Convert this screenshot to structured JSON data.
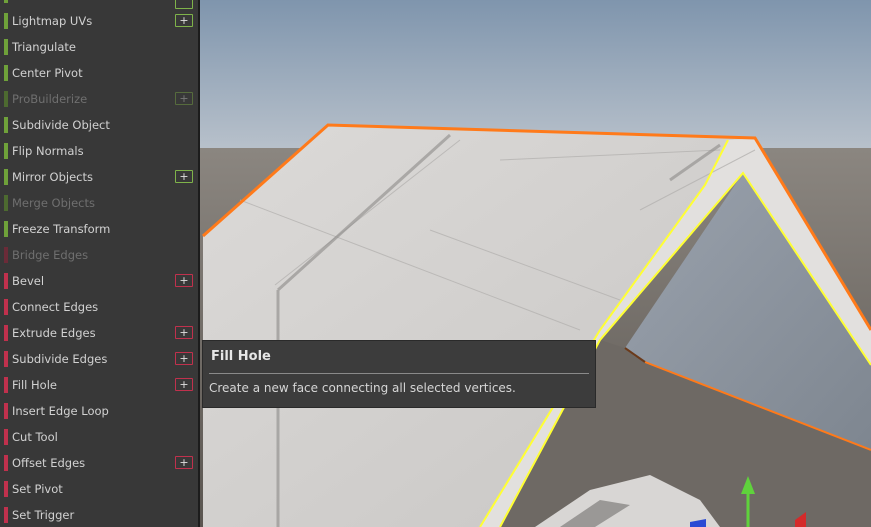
{
  "tool_panel": {
    "items": [
      {
        "label": "Lightmap UVs",
        "color": "green",
        "has_plus": true,
        "enabled": true
      },
      {
        "label": "Triangulate",
        "color": "green",
        "has_plus": false,
        "enabled": true
      },
      {
        "label": "Center Pivot",
        "color": "green",
        "has_plus": false,
        "enabled": true
      },
      {
        "label": "ProBuilderize",
        "color": "green",
        "has_plus": true,
        "enabled": false
      },
      {
        "label": "Subdivide Object",
        "color": "green",
        "has_plus": false,
        "enabled": true
      },
      {
        "label": "Flip Normals",
        "color": "green",
        "has_plus": false,
        "enabled": true
      },
      {
        "label": "Mirror Objects",
        "color": "green",
        "has_plus": true,
        "enabled": true
      },
      {
        "label": "Merge Objects",
        "color": "green",
        "has_plus": false,
        "enabled": false
      },
      {
        "label": "Freeze Transform",
        "color": "green",
        "has_plus": false,
        "enabled": true
      },
      {
        "label": "Bridge Edges",
        "color": "red",
        "has_plus": false,
        "enabled": false
      },
      {
        "label": "Bevel",
        "color": "red",
        "has_plus": true,
        "enabled": true
      },
      {
        "label": "Connect Edges",
        "color": "red",
        "has_plus": false,
        "enabled": true
      },
      {
        "label": "Extrude Edges",
        "color": "red",
        "has_plus": true,
        "enabled": true
      },
      {
        "label": "Subdivide Edges",
        "color": "red",
        "has_plus": true,
        "enabled": true
      },
      {
        "label": "Fill Hole",
        "color": "red",
        "has_plus": true,
        "enabled": true
      },
      {
        "label": "Insert Edge Loop",
        "color": "red",
        "has_plus": false,
        "enabled": true
      },
      {
        "label": "Cut Tool",
        "color": "red",
        "has_plus": false,
        "enabled": true
      },
      {
        "label": "Offset Edges",
        "color": "red",
        "has_plus": true,
        "enabled": true
      },
      {
        "label": "Set Pivot",
        "color": "red",
        "has_plus": false,
        "enabled": true
      },
      {
        "label": "Set Trigger",
        "color": "red",
        "has_plus": false,
        "enabled": true
      }
    ],
    "plus_glyph": "+"
  },
  "tooltip": {
    "title": "Fill Hole",
    "description": "Create a new face connecting all selected vertices."
  },
  "colors": {
    "panel_bg": "#383838",
    "green_category": "#6fa13a",
    "red_category": "#c0314d",
    "selection_orange": "#ff7a1a",
    "selection_yellow": "#ffff33",
    "gizmo_y_axis": "#5fd23c",
    "gizmo_x_axis": "#d42a2a",
    "gizmo_z_axis": "#2a4ad4"
  }
}
